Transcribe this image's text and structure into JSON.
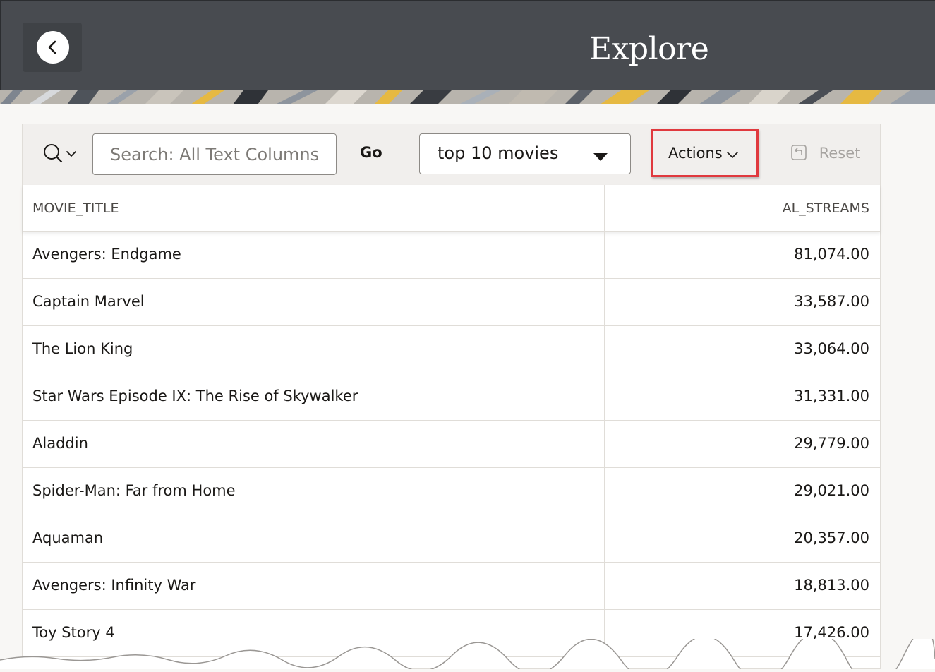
{
  "header": {
    "title": "Explore",
    "back_icon": "chevron-left-icon"
  },
  "toolbar": {
    "search_icon": "search-icon",
    "search_placeholder": "Search: All Text Columns",
    "search_value": "",
    "go_label": "Go",
    "report_selected": "top 10 movies",
    "actions_label": "Actions",
    "reset_label": "Reset",
    "highlight_color": "#e0393e"
  },
  "table": {
    "columns": [
      "MOVIE_TITLE",
      "AL_STREAMS"
    ],
    "rows": [
      {
        "title": "Avengers: Endgame",
        "streams": "81,074.00"
      },
      {
        "title": "Captain Marvel",
        "streams": "33,587.00"
      },
      {
        "title": "The Lion King",
        "streams": "33,064.00"
      },
      {
        "title": "Star Wars Episode IX: The Rise of Skywalker",
        "streams": "31,331.00"
      },
      {
        "title": "Aladdin",
        "streams": "29,779.00"
      },
      {
        "title": "Spider-Man: Far from Home",
        "streams": "29,021.00"
      },
      {
        "title": "Aquaman",
        "streams": "20,357.00"
      },
      {
        "title": "Avengers: Infinity War",
        "streams": "18,813.00"
      },
      {
        "title": "Toy Story 4",
        "streams": "17,426.00"
      }
    ]
  }
}
